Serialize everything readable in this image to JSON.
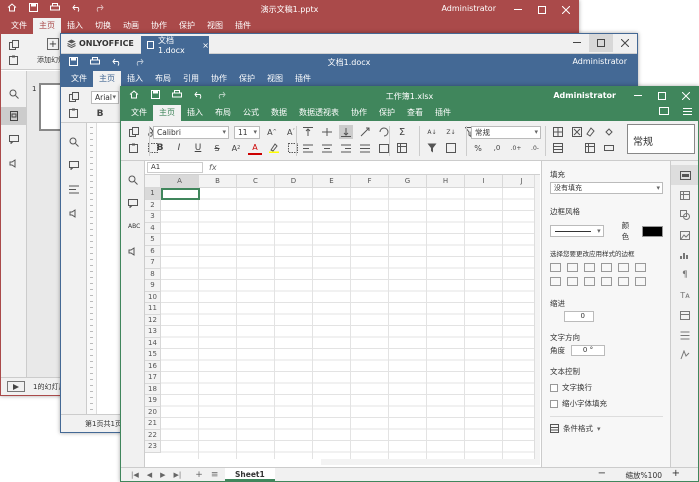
{
  "ppt": {
    "title": "演示文稿1.pptx",
    "user": "Administrator",
    "tabs": [
      {
        "label": "文件"
      },
      {
        "label": "主页"
      },
      {
        "label": "插入"
      },
      {
        "label": "切换"
      },
      {
        "label": "动画"
      },
      {
        "label": "协作"
      },
      {
        "label": "保护"
      },
      {
        "label": "视图"
      },
      {
        "label": "插件"
      }
    ],
    "add_slide_label": "添加幻灯",
    "slide_number": "1",
    "status": "1的幻灯片"
  },
  "doc": {
    "brand": "ONLYOFFICE",
    "doc_tab": "文档1.docx",
    "title": "文档1.docx",
    "user": "Administrator",
    "tabs": [
      {
        "label": "文件"
      },
      {
        "label": "主页"
      },
      {
        "label": "插入"
      },
      {
        "label": "布局"
      },
      {
        "label": "引用"
      },
      {
        "label": "协作"
      },
      {
        "label": "保护"
      },
      {
        "label": "视图"
      },
      {
        "label": "插件"
      }
    ],
    "font": "Arial",
    "status": "第1页共1页"
  },
  "xls": {
    "title": "工作簿1.xlsx",
    "user": "Administrator",
    "tabs": [
      {
        "label": "文件"
      },
      {
        "label": "主页"
      },
      {
        "label": "插入"
      },
      {
        "label": "布局"
      },
      {
        "label": "公式"
      },
      {
        "label": "数据"
      },
      {
        "label": "数据透视表"
      },
      {
        "label": "协作"
      },
      {
        "label": "保护"
      },
      {
        "label": "查看"
      },
      {
        "label": "插件"
      }
    ],
    "font_name": "Calibri",
    "font_size": "11",
    "number_format": "常规",
    "cell_style": "常规",
    "percent": "%",
    "cell_ref": "A1",
    "fx": "fx",
    "columns": [
      "A",
      "B",
      "C",
      "D",
      "E",
      "F",
      "G",
      "H",
      "I",
      "J"
    ],
    "rows": [
      "1",
      "2",
      "3",
      "4",
      "5",
      "6",
      "7",
      "8",
      "9",
      "10",
      "11",
      "12",
      "13",
      "14",
      "15",
      "16",
      "17",
      "18",
      "19",
      "20",
      "21",
      "22",
      "23"
    ],
    "panel": {
      "fill_label": "填充",
      "fill_value": "没有填充",
      "border_style_label": "边框风格",
      "color_label": "颜色",
      "border_hint": "选择您要更改应用样式的边框",
      "indent_label": "缩进",
      "indent_value": "0",
      "text_dir_label": "文字方向",
      "angle_label": "角度",
      "angle_value": "0 °",
      "text_control_label": "文本控制",
      "wrap_text": "文字换行",
      "shrink_fit": "缩小字体填充",
      "cond_format": "条件格式"
    },
    "sheet_tab": "Sheet1",
    "zoom": "缩放%100"
  },
  "colors": {
    "ppt": "#aa4a4a",
    "doc": "#446995",
    "xls": "#40865c"
  }
}
